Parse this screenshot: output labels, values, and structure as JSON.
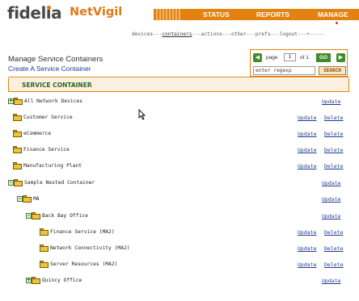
{
  "header": {
    "logo": "fidelia",
    "brand": "NetVigil",
    "nav": {
      "status": "STATUS",
      "reports": "REPORTS",
      "manage": "MANAGE"
    },
    "subnav": {
      "devices": "devices",
      "sep1": "---",
      "containers": "containers",
      "sep2": "---",
      "actions": "actions",
      "sep3": "---",
      "other": "other",
      "sep4": "---",
      "prefs": "prefs",
      "sep5": "---",
      "logout": "logout",
      "tail": "---+-----"
    },
    "colors": {
      "accent": "#e4820f",
      "brand_text": "#e07a17",
      "green": "#3f8c2a",
      "link": "#1c3c8c"
    }
  },
  "page": {
    "title": "Manage Service Containers",
    "create_link": "Create A Service Container"
  },
  "pager": {
    "prev_icon": "arrow-left-icon",
    "page_label": "page",
    "page_value": "1",
    "of_label": "of 1",
    "go_label": "GO",
    "next_icon": "arrow-right-icon",
    "search_value": "enter regexp",
    "search_label": "SEARCH"
  },
  "section": {
    "header": "SERVICE CONTAINER"
  },
  "actions": {
    "update": "Update",
    "delete": "Delete"
  },
  "tree": [
    {
      "label": "All Network Devices",
      "expander": "+",
      "has_delete": false
    },
    {
      "label": "Customer Service",
      "expander": "",
      "has_delete": true
    },
    {
      "label": "eCommerce",
      "expander": "",
      "has_delete": true
    },
    {
      "label": "Finance Service",
      "expander": "",
      "has_delete": true
    },
    {
      "label": "Manufacturing Plant",
      "expander": "",
      "has_delete": true
    },
    {
      "label": "Sample Nested Container",
      "expander": "-",
      "has_delete": false
    },
    {
      "label": "MA",
      "expander": "-",
      "has_delete": false
    },
    {
      "label": "Back Bay Office",
      "expander": "-",
      "has_delete": false
    },
    {
      "label": "Finance Service (MA2)",
      "expander": "",
      "has_delete": true
    },
    {
      "label": "Network Connectivity (MA2)",
      "expander": "",
      "has_delete": true
    },
    {
      "label": "Server Resources (MA2)",
      "expander": "",
      "has_delete": true
    },
    {
      "label": "Quincy Office",
      "expander": "+",
      "has_delete": false
    }
  ]
}
